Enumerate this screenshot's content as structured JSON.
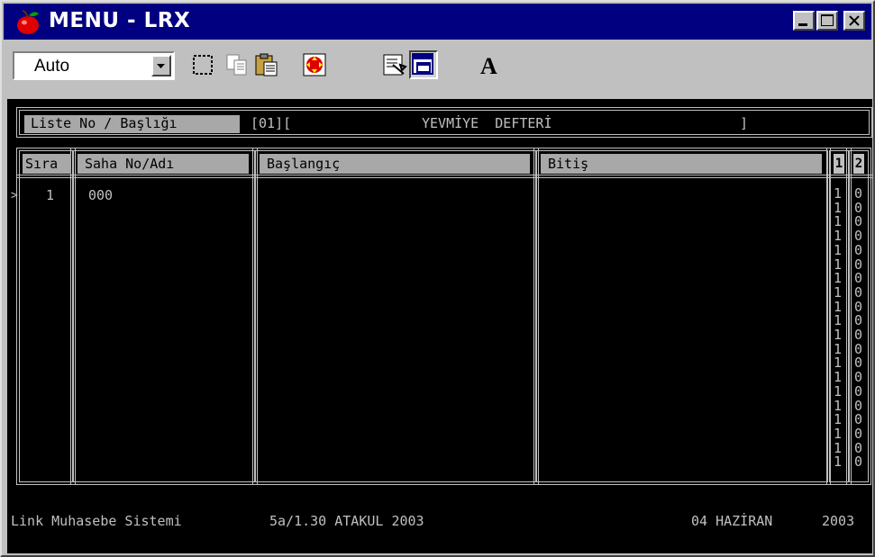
{
  "window": {
    "title": "MENU - LRX"
  },
  "toolbar": {
    "font_combo_value": "Auto",
    "tools": [
      "select-icon",
      "copy-icon",
      "paste-icon",
      "fullscreen-icon",
      "properties-icon",
      "background-icon",
      "font-icon"
    ],
    "font_tool_label": "A"
  },
  "terminal": {
    "list_title_label": "Liste No / Başlığı",
    "list_no": "[01][",
    "list_name": "YEVMİYE  DEFTERİ",
    "list_close": "]",
    "columns": [
      "Sıra",
      "Saha No/Adı",
      "Başlangıç",
      "Bitiş",
      "1",
      "2"
    ],
    "rows": [
      {
        "cursor": ">",
        "sira": "1",
        "saha": "000",
        "baslangic": "",
        "bitis": ""
      }
    ],
    "flag_col_1": [
      "1",
      "1",
      "1",
      "1",
      "1",
      "1",
      "1",
      "1",
      "1",
      "1",
      "1",
      "1",
      "1",
      "1",
      "1",
      "1",
      "1",
      "1",
      "1",
      "1"
    ],
    "flag_col_2": [
      "0",
      "0",
      "0",
      "0",
      "0",
      "0",
      "0",
      "0",
      "0",
      "0",
      "0",
      "0",
      "0",
      "0",
      "0",
      "0",
      "0",
      "0",
      "0",
      "0"
    ],
    "status_app": "Link Muhasebe Sistemi",
    "status_version": "5a/1.30 ATAKUL 2003",
    "status_date": "04 HAZİRAN",
    "status_year": "2003"
  },
  "colors": {
    "titlebar": "#000080",
    "chrome": "#c0c0c0",
    "terminal_bg": "#000000",
    "terminal_fg": "#c0c0c0"
  }
}
